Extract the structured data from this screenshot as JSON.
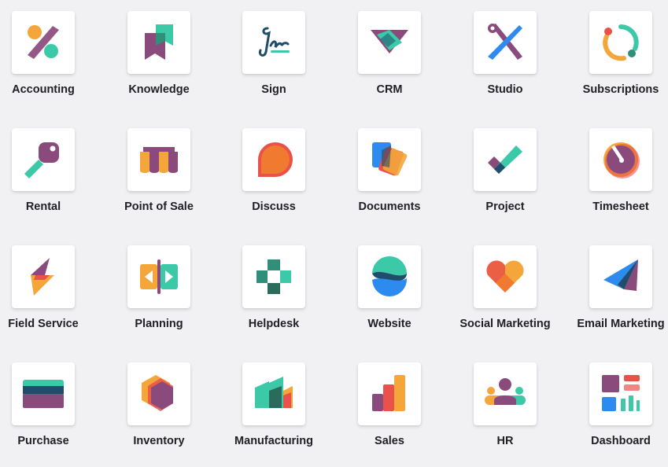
{
  "apps": [
    {
      "label": "Accounting",
      "icon": "accounting-icon"
    },
    {
      "label": "Knowledge",
      "icon": "knowledge-icon"
    },
    {
      "label": "Sign",
      "icon": "sign-icon"
    },
    {
      "label": "CRM",
      "icon": "crm-icon"
    },
    {
      "label": "Studio",
      "icon": "studio-icon"
    },
    {
      "label": "Subscriptions",
      "icon": "subscriptions-icon"
    },
    {
      "label": "Rental",
      "icon": "rental-icon"
    },
    {
      "label": "Point of Sale",
      "icon": "point-of-sale-icon"
    },
    {
      "label": "Discuss",
      "icon": "discuss-icon"
    },
    {
      "label": "Documents",
      "icon": "documents-icon"
    },
    {
      "label": "Project",
      "icon": "project-icon"
    },
    {
      "label": "Timesheet",
      "icon": "timesheet-icon"
    },
    {
      "label": "Field Service",
      "icon": "field-service-icon"
    },
    {
      "label": "Planning",
      "icon": "planning-icon"
    },
    {
      "label": "Helpdesk",
      "icon": "helpdesk-icon"
    },
    {
      "label": "Website",
      "icon": "website-icon"
    },
    {
      "label": "Social Marketing",
      "icon": "social-marketing-icon"
    },
    {
      "label": "Email Marketing",
      "icon": "email-marketing-icon"
    },
    {
      "label": "Purchase",
      "icon": "purchase-icon"
    },
    {
      "label": "Inventory",
      "icon": "inventory-icon"
    },
    {
      "label": "Manufacturing",
      "icon": "manufacturing-icon"
    },
    {
      "label": "Sales",
      "icon": "sales-icon"
    },
    {
      "label": "HR",
      "icon": "hr-icon"
    },
    {
      "label": "Dashboard",
      "icon": "dashboard-icon"
    }
  ],
  "colors": {
    "background": "#f1f1f4",
    "tile": "#ffffff",
    "purple": "#8a4a7c",
    "teal": "#3cc9a8",
    "orange": "#f4a63b",
    "red": "#e9524a",
    "blue": "#2d8bf0",
    "navy": "#1f4d6b"
  }
}
